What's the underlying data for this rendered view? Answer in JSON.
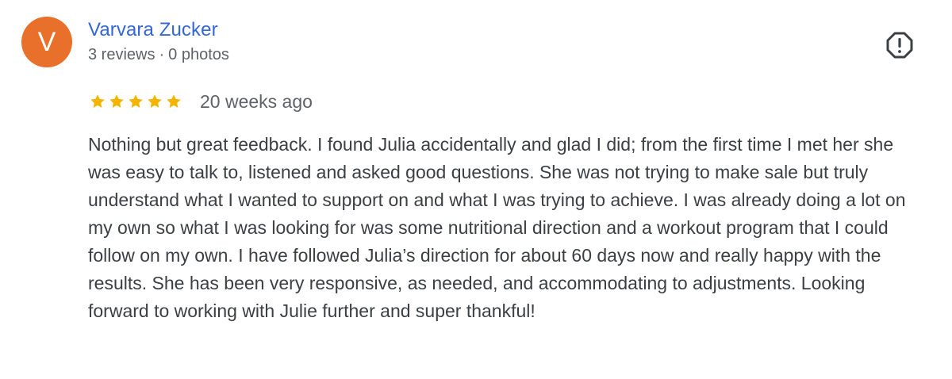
{
  "reviewer": {
    "initial": "V",
    "avatar_color": "#e8702a",
    "name": "Varvara Zucker",
    "reviews": "3 reviews",
    "separator": "·",
    "photos": "0 photos"
  },
  "rating": {
    "stars": 5,
    "max_stars": 5,
    "star_color": "#f4b400",
    "date": "20 weeks ago"
  },
  "review": {
    "text": "Nothing but great feedback. I found Julia accidentally and glad I did; from the first time I met her she was easy to talk to, listened and asked good questions. She was not trying to make sale but truly understand what I wanted to support on and what I was trying to achieve. I was already doing a lot on my own so what I was looking for was some nutritional direction and a workout program that I could follow on my own. I have followed Julia’s direction for about 60 days now and really happy with the results. She has been very responsive, as needed, and accommodating to adjustments. Looking forward to working with Julie further and super thankful!"
  },
  "icons": {
    "flag": "report-octagon-icon",
    "star": "star-icon"
  }
}
